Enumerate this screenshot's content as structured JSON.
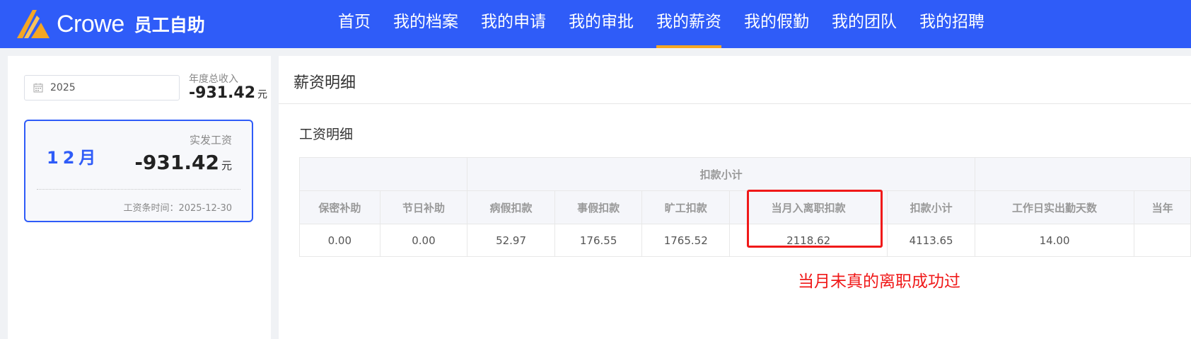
{
  "header": {
    "brand": "Crowe",
    "subtitle": "员工自助",
    "nav": [
      {
        "label": "首页",
        "active": false
      },
      {
        "label": "我的档案",
        "active": false
      },
      {
        "label": "我的申请",
        "active": false
      },
      {
        "label": "我的审批",
        "active": false
      },
      {
        "label": "我的薪资",
        "active": true
      },
      {
        "label": "我的假勤",
        "active": false
      },
      {
        "label": "我的团队",
        "active": false
      },
      {
        "label": "我的招聘",
        "active": false
      }
    ]
  },
  "sidebar": {
    "year_value": "2025",
    "annual_income_label": "年度总收入",
    "annual_income_value": "-931.42",
    "currency_unit": "元",
    "month_card": {
      "month": "12月",
      "pay_label": "实发工资",
      "pay_value": "-931.42",
      "pay_unit": "元",
      "slip_time": "工资条时间：2025-12-30"
    }
  },
  "main": {
    "title": "薪资明细",
    "section_title": "工资明细",
    "table": {
      "group_header": "扣款小计",
      "columns": [
        "保密补助",
        "节日补助",
        "病假扣款",
        "事假扣款",
        "旷工扣款",
        "当月入离职扣款",
        "扣款小计",
        "工作日实出勤天数",
        "当年"
      ],
      "row": [
        "0.00",
        "0.00",
        "52.97",
        "176.55",
        "1765.52",
        "2118.62",
        "4113.65",
        "14.00",
        ""
      ]
    },
    "annotation": "当月未真的离职成功过"
  },
  "colors": {
    "primary": "#2f5cf8",
    "nav_indicator": "#f5a623",
    "annotation_red": "#f01919",
    "logo_gold": "#f5a623"
  }
}
